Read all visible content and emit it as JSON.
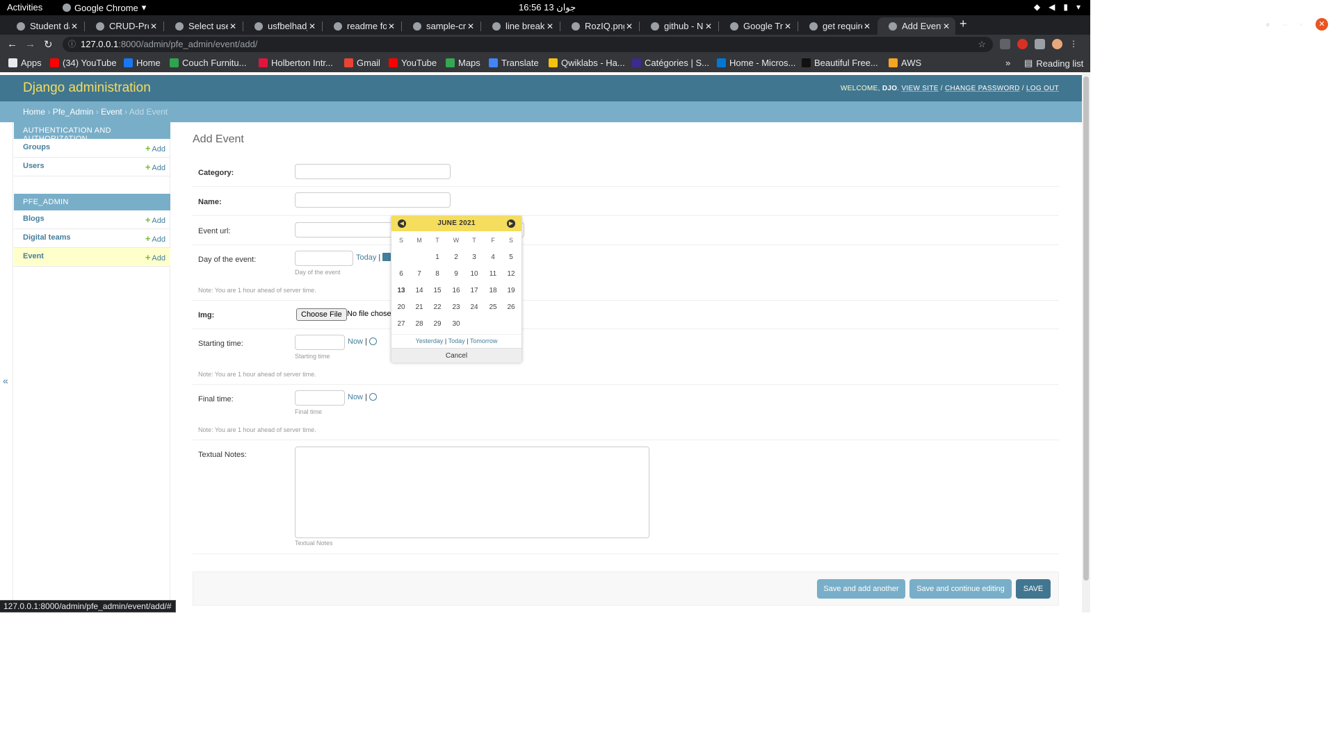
{
  "os_bar": {
    "activities": "Activities",
    "app_name": "Google Chrome",
    "clock": "16:56  جوان 13"
  },
  "browser": {
    "tabs": [
      {
        "title": "Student da",
        "active": false
      },
      {
        "title": "CRUD-Proj",
        "active": false
      },
      {
        "title": "Select user",
        "active": false
      },
      {
        "title": "usfbelhadj",
        "active": false
      },
      {
        "title": "readme for",
        "active": false
      },
      {
        "title": "sample-cru",
        "active": false
      },
      {
        "title": "line break",
        "active": false
      },
      {
        "title": "RozIQ.png",
        "active": false
      },
      {
        "title": "github - Ne",
        "active": false
      },
      {
        "title": "Google Tra",
        "active": false
      },
      {
        "title": "get require",
        "active": false
      },
      {
        "title": "Add Event",
        "active": true
      }
    ],
    "url_host": "127.0.0.1",
    "url_path": ":8000/admin/pfe_admin/event/add/",
    "bookmarks": [
      {
        "label": "Apps",
        "color": "#e8eaed"
      },
      {
        "label": "(34) YouTube",
        "color": "#ff0000"
      },
      {
        "label": "Home",
        "color": "#1877f2"
      },
      {
        "label": "Couch Furnitu...",
        "color": "#2ea44f"
      },
      {
        "label": "Holberton Intr...",
        "color": "#e0153e"
      },
      {
        "label": "Gmail",
        "color": "#ea4335"
      },
      {
        "label": "YouTube",
        "color": "#ff0000"
      },
      {
        "label": "Maps",
        "color": "#34a853"
      },
      {
        "label": "Translate",
        "color": "#4285f4"
      },
      {
        "label": "Qwiklabs - Ha...",
        "color": "#f4c20d"
      },
      {
        "label": "Catégories | S...",
        "color": "#3d2a8f"
      },
      {
        "label": "Home - Micros...",
        "color": "#0078d4"
      },
      {
        "label": "Beautiful Free...",
        "color": "#111111"
      },
      {
        "label": "AWS",
        "color": "#f5a623"
      }
    ],
    "reading_list": "Reading list",
    "status_url": "127.0.0.1:8000/admin/pfe_admin/event/add/#"
  },
  "header": {
    "site_name": "Django administration",
    "welcome": "WELCOME, ",
    "username": "DJO",
    "view_site": "VIEW SITE",
    "change_password": "CHANGE PASSWORD",
    "log_out": "LOG OUT"
  },
  "breadcrumbs": {
    "home": "Home",
    "app": "Pfe_Admin",
    "model": "Event",
    "current": "Add Event"
  },
  "sidebar": {
    "add_label": "Add",
    "auth_caption": "AUTHENTICATION AND AUTHORIZATION",
    "auth_models": [
      "Groups",
      "Users"
    ],
    "app_caption": "PFE_ADMIN",
    "app_models": [
      "Blogs",
      "Digital teams",
      "Event"
    ],
    "collapse": "«"
  },
  "form": {
    "title": "Add Event",
    "category_label": "Category:",
    "name_label": "Name:",
    "event_url_label": "Event url:",
    "day_label": "Day of the event:",
    "day_today": "Today",
    "day_help": "Day of the event",
    "tz_note": "Note: You are 1 hour ahead of server time.",
    "img_label": "Img:",
    "choose_file": "Choose File",
    "no_file": "No file chosen",
    "start_label": "Starting time:",
    "now": "Now",
    "start_help": "Starting time",
    "final_label": "Final time:",
    "final_help": "Final time",
    "notes_label": "Textual Notes:",
    "notes_help": "Textual Notes",
    "sep": "|"
  },
  "buttons": {
    "save_add_another": "Save and add another",
    "save_continue": "Save and continue editing",
    "save": "SAVE"
  },
  "calendar": {
    "caption": "JUNE 2021",
    "weekdays": [
      "S",
      "M",
      "T",
      "W",
      "T",
      "F",
      "S"
    ],
    "days": [
      "1",
      "2",
      "3",
      "4",
      "5",
      "6",
      "7",
      "8",
      "9",
      "10",
      "11",
      "12",
      "13",
      "14",
      "15",
      "16",
      "17",
      "18",
      "19",
      "20",
      "21",
      "22",
      "23",
      "24",
      "25",
      "26",
      "27",
      "28",
      "29",
      "30"
    ],
    "today": "13",
    "yesterday": "Yesterday",
    "today_label": "Today",
    "tomorrow": "Tomorrow",
    "cancel": "Cancel"
  }
}
